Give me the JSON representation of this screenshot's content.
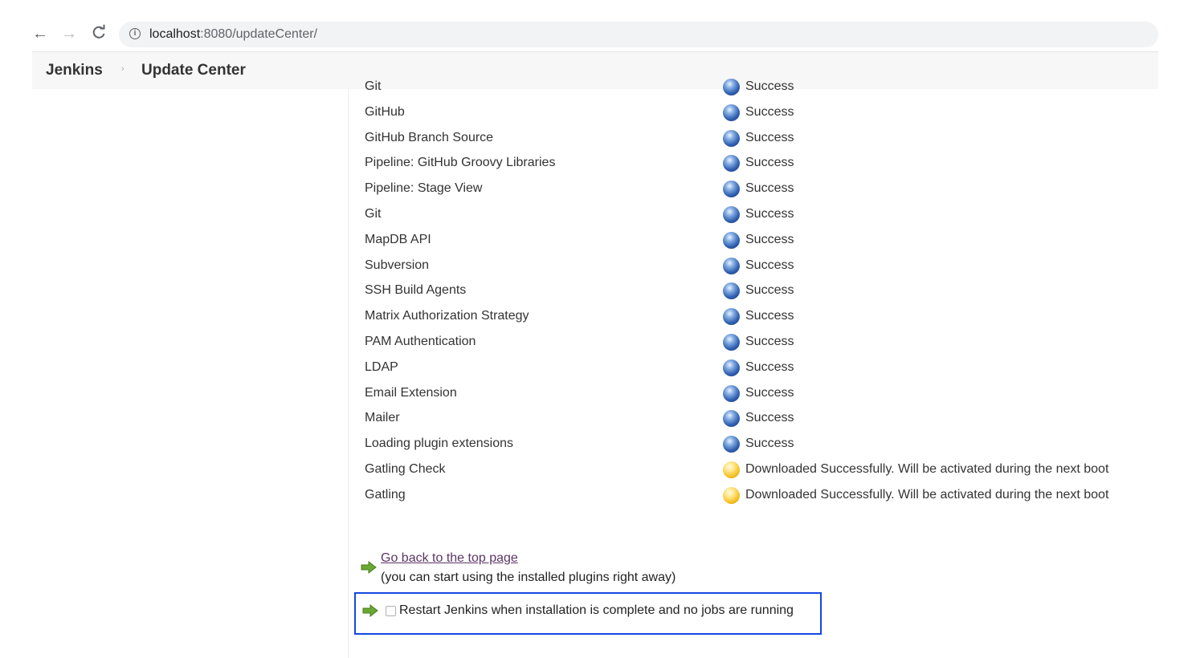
{
  "browser": {
    "back_icon": "←",
    "forward_icon": "→",
    "reload_icon": "C",
    "info_icon": "i",
    "url_host": "localhost",
    "url_rest": ":8080/updateCenter/"
  },
  "breadcrumb": {
    "home": "Jenkins",
    "separator": "›",
    "current": "Update Center"
  },
  "partial_row": {
    "name": "Git",
    "status": "Success",
    "icon": "blue-ball-icon"
  },
  "plugins": [
    {
      "name": "GitHub",
      "status": "Success",
      "icon": "blue-ball-icon"
    },
    {
      "name": "GitHub Branch Source",
      "status": "Success",
      "icon": "blue-ball-icon"
    },
    {
      "name": "Pipeline: GitHub Groovy Libraries",
      "status": "Success",
      "icon": "blue-ball-icon"
    },
    {
      "name": "Pipeline: Stage View",
      "status": "Success",
      "icon": "blue-ball-icon"
    },
    {
      "name": "Git",
      "status": "Success",
      "icon": "blue-ball-icon"
    },
    {
      "name": "MapDB API",
      "status": "Success",
      "icon": "blue-ball-icon"
    },
    {
      "name": "Subversion",
      "status": "Success",
      "icon": "blue-ball-icon"
    },
    {
      "name": "SSH Build Agents",
      "status": "Success",
      "icon": "blue-ball-icon"
    },
    {
      "name": "Matrix Authorization Strategy",
      "status": "Success",
      "icon": "blue-ball-icon"
    },
    {
      "name": "PAM Authentication",
      "status": "Success",
      "icon": "blue-ball-icon"
    },
    {
      "name": "LDAP",
      "status": "Success",
      "icon": "blue-ball-icon"
    },
    {
      "name": "Email Extension",
      "status": "Success",
      "icon": "blue-ball-icon"
    },
    {
      "name": "Mailer",
      "status": "Success",
      "icon": "blue-ball-icon"
    },
    {
      "name": "Loading plugin extensions",
      "status": "Success",
      "icon": "blue-ball-icon"
    },
    {
      "name": "Gatling Check",
      "status": "Downloaded Successfully. Will be activated during the next boot",
      "icon": "yellow-ball-icon"
    },
    {
      "name": "Gatling",
      "status": "Downloaded Successfully. Will be activated during the next boot",
      "icon": "yellow-ball-icon"
    }
  ],
  "footer": {
    "go_back_label": "Go back to the top page",
    "go_back_note": "(you can start using the installed plugins right away)",
    "restart_label": "Restart Jenkins when installation is complete and no jobs are running",
    "restart_checked": false
  },
  "colors": {
    "highlight_border": "#1447e0",
    "link": "#5c3566",
    "success_ball": "#2f5fb0",
    "pending_ball": "#f5c020",
    "arrow": "#6aa832"
  }
}
